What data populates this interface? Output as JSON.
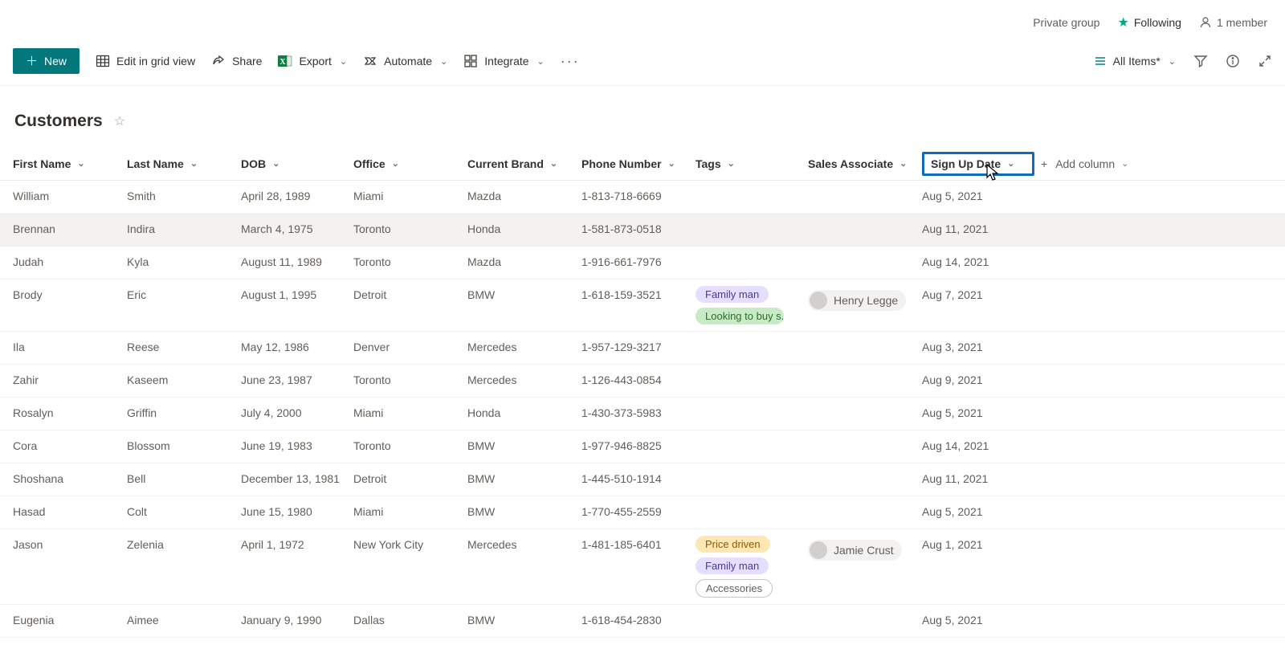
{
  "topbar": {
    "privacy": "Private group",
    "following_label": "Following",
    "members_label": "1 member"
  },
  "cmdbar": {
    "new_label": "New",
    "edit_grid_label": "Edit in grid view",
    "share_label": "Share",
    "export_label": "Export",
    "automate_label": "Automate",
    "integrate_label": "Integrate",
    "view_selector_label": "All Items*"
  },
  "list": {
    "title": "Customers"
  },
  "columns": {
    "first_name": "First Name",
    "last_name": "Last Name",
    "dob": "DOB",
    "office": "Office",
    "current_brand": "Current Brand",
    "phone": "Phone Number",
    "tags": "Tags",
    "sales_associate": "Sales Associate",
    "sign_up_date": "Sign Up Date",
    "add_column": "Add column"
  },
  "tag_styles": {
    "Family man": "tag-purple",
    "Looking to buy s...": "tag-green",
    "Price driven": "tag-amber",
    "Accessories": "tag-outline"
  },
  "rows": [
    {
      "first": "William",
      "last": "Smith",
      "dob": "April 28, 1989",
      "office": "Miami",
      "brand": "Mazda",
      "phone": "1-813-718-6669",
      "tags": [],
      "assoc": "",
      "signup": "Aug 5, 2021",
      "highlight": false
    },
    {
      "first": "Brennan",
      "last": "Indira",
      "dob": "March 4, 1975",
      "office": "Toronto",
      "brand": "Honda",
      "phone": "1-581-873-0518",
      "tags": [],
      "assoc": "",
      "signup": "Aug 11, 2021",
      "highlight": true
    },
    {
      "first": "Judah",
      "last": "Kyla",
      "dob": "August 11, 1989",
      "office": "Toronto",
      "brand": "Mazda",
      "phone": "1-916-661-7976",
      "tags": [],
      "assoc": "",
      "signup": "Aug 14, 2021",
      "highlight": false
    },
    {
      "first": "Brody",
      "last": "Eric",
      "dob": "August 1, 1995",
      "office": "Detroit",
      "brand": "BMW",
      "phone": "1-618-159-3521",
      "tags": [
        "Family man",
        "Looking to buy s..."
      ],
      "assoc": "Henry Legge",
      "signup": "Aug 7, 2021",
      "highlight": false
    },
    {
      "first": "Ila",
      "last": "Reese",
      "dob": "May 12, 1986",
      "office": "Denver",
      "brand": "Mercedes",
      "phone": "1-957-129-3217",
      "tags": [],
      "assoc": "",
      "signup": "Aug 3, 2021",
      "highlight": false
    },
    {
      "first": "Zahir",
      "last": "Kaseem",
      "dob": "June 23, 1987",
      "office": "Toronto",
      "brand": "Mercedes",
      "phone": "1-126-443-0854",
      "tags": [],
      "assoc": "",
      "signup": "Aug 9, 2021",
      "highlight": false
    },
    {
      "first": "Rosalyn",
      "last": "Griffin",
      "dob": "July 4, 2000",
      "office": "Miami",
      "brand": "Honda",
      "phone": "1-430-373-5983",
      "tags": [],
      "assoc": "",
      "signup": "Aug 5, 2021",
      "highlight": false
    },
    {
      "first": "Cora",
      "last": "Blossom",
      "dob": "June 19, 1983",
      "office": "Toronto",
      "brand": "BMW",
      "phone": "1-977-946-8825",
      "tags": [],
      "assoc": "",
      "signup": "Aug 14, 2021",
      "highlight": false
    },
    {
      "first": "Shoshana",
      "last": "Bell",
      "dob": "December 13, 1981",
      "office": "Detroit",
      "brand": "BMW",
      "phone": "1-445-510-1914",
      "tags": [],
      "assoc": "",
      "signup": "Aug 11, 2021",
      "highlight": false
    },
    {
      "first": "Hasad",
      "last": "Colt",
      "dob": "June 15, 1980",
      "office": "Miami",
      "brand": "BMW",
      "phone": "1-770-455-2559",
      "tags": [],
      "assoc": "",
      "signup": "Aug 5, 2021",
      "highlight": false
    },
    {
      "first": "Jason",
      "last": "Zelenia",
      "dob": "April 1, 1972",
      "office": "New York City",
      "brand": "Mercedes",
      "phone": "1-481-185-6401",
      "tags": [
        "Price driven",
        "Family man",
        "Accessories"
      ],
      "assoc": "Jamie Crust",
      "signup": "Aug 1, 2021",
      "highlight": false
    },
    {
      "first": "Eugenia",
      "last": "Aimee",
      "dob": "January 9, 1990",
      "office": "Dallas",
      "brand": "BMW",
      "phone": "1-618-454-2830",
      "tags": [],
      "assoc": "",
      "signup": "Aug 5, 2021",
      "highlight": false
    }
  ]
}
